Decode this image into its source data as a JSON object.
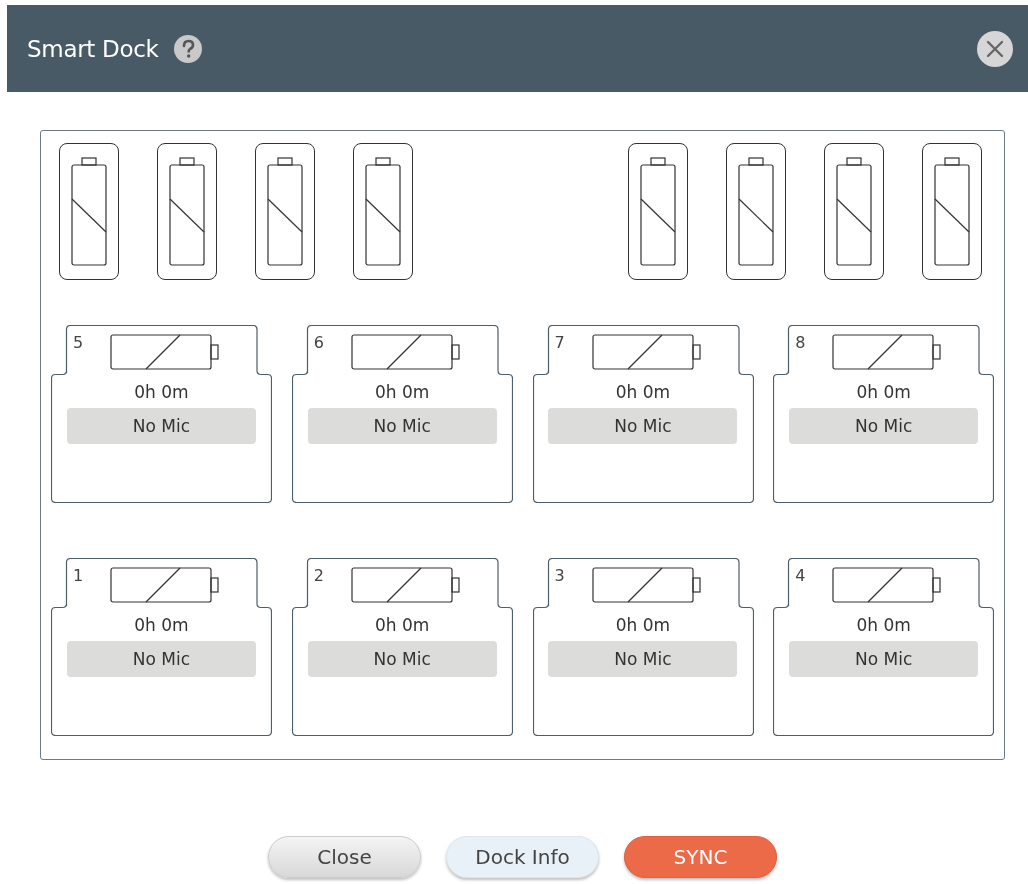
{
  "window": {
    "title": "Smart Dock"
  },
  "battery_bays": {
    "left": [
      {
        "empty": true
      },
      {
        "empty": true
      },
      {
        "empty": true
      },
      {
        "empty": true
      }
    ],
    "right": [
      {
        "empty": true
      },
      {
        "empty": true
      },
      {
        "empty": true
      },
      {
        "empty": true
      }
    ]
  },
  "mic_slot_rows": [
    [
      {
        "number": "5",
        "time": "0h 0m",
        "status": "No Mic",
        "battery_empty": true
      },
      {
        "number": "6",
        "time": "0h 0m",
        "status": "No Mic",
        "battery_empty": true
      },
      {
        "number": "7",
        "time": "0h 0m",
        "status": "No Mic",
        "battery_empty": true
      },
      {
        "number": "8",
        "time": "0h 0m",
        "status": "No Mic",
        "battery_empty": true
      }
    ],
    [
      {
        "number": "1",
        "time": "0h 0m",
        "status": "No Mic",
        "battery_empty": true
      },
      {
        "number": "2",
        "time": "0h 0m",
        "status": "No Mic",
        "battery_empty": true
      },
      {
        "number": "3",
        "time": "0h 0m",
        "status": "No Mic",
        "battery_empty": true
      },
      {
        "number": "4",
        "time": "0h 0m",
        "status": "No Mic",
        "battery_empty": true
      }
    ]
  ],
  "buttons": [
    {
      "label": "Close",
      "kind": "default"
    },
    {
      "label": "Dock Info",
      "kind": "info"
    },
    {
      "label": "SYNC",
      "kind": "primary"
    }
  ]
}
